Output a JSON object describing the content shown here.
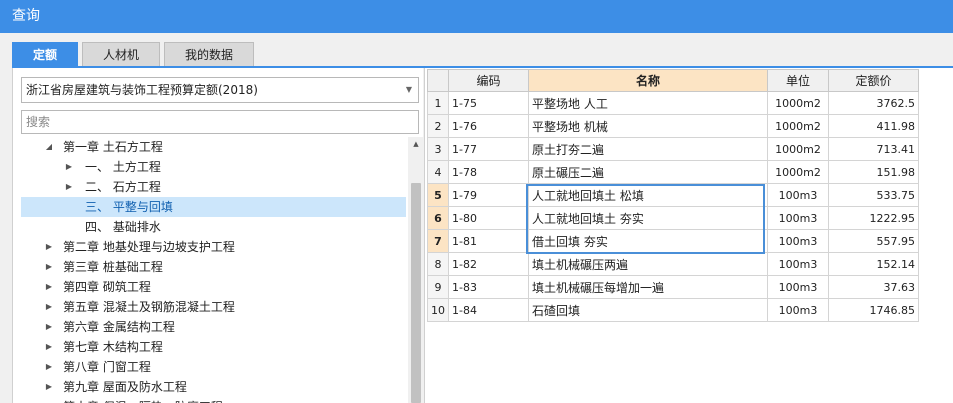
{
  "window": {
    "title": "查询"
  },
  "tabs": [
    {
      "label": "定额",
      "active": true
    },
    {
      "label": "人材机",
      "active": false
    },
    {
      "label": "我的数据",
      "active": false
    }
  ],
  "library": {
    "selected": "浙江省房屋建筑与装饰工程预算定额(2018)"
  },
  "search": {
    "placeholder": "搜索",
    "value": ""
  },
  "tree": [
    {
      "text": "第一章 土石方工程",
      "level": 0,
      "expanded": true,
      "selected": false
    },
    {
      "text": "一、 土方工程",
      "level": 1,
      "expanded": false,
      "selected": false
    },
    {
      "text": "二、 石方工程",
      "level": 1,
      "expanded": false,
      "selected": false
    },
    {
      "text": "三、 平整与回填",
      "level": 1,
      "leaf": true,
      "selected": true
    },
    {
      "text": "四、 基础排水",
      "level": 1,
      "leaf": true,
      "selected": false
    },
    {
      "text": "第二章 地基处理与边坡支护工程",
      "level": 0,
      "expanded": false,
      "selected": false
    },
    {
      "text": "第三章 桩基础工程",
      "level": 0,
      "expanded": false,
      "selected": false
    },
    {
      "text": "第四章 砌筑工程",
      "level": 0,
      "expanded": false,
      "selected": false
    },
    {
      "text": "第五章 混凝土及钢筋混凝土工程",
      "level": 0,
      "expanded": false,
      "selected": false
    },
    {
      "text": "第六章 金属结构工程",
      "level": 0,
      "expanded": false,
      "selected": false
    },
    {
      "text": "第七章 木结构工程",
      "level": 0,
      "expanded": false,
      "selected": false
    },
    {
      "text": "第八章 门窗工程",
      "level": 0,
      "expanded": false,
      "selected": false
    },
    {
      "text": "第九章 屋面及防水工程",
      "level": 0,
      "expanded": false,
      "selected": false
    },
    {
      "text": "第十章 保温、隔热、防腐工程",
      "level": 0,
      "expanded": false,
      "selected": false
    }
  ],
  "table": {
    "columns": [
      "",
      "编码",
      "名称",
      "单位",
      "定额价"
    ],
    "rows": [
      {
        "idx": "1",
        "code": "1-75",
        "name": "平整场地 人工",
        "unit": "1000m2",
        "price": "3762.5",
        "selected": false
      },
      {
        "idx": "2",
        "code": "1-76",
        "name": "平整场地 机械",
        "unit": "1000m2",
        "price": "411.98",
        "selected": false
      },
      {
        "idx": "3",
        "code": "1-77",
        "name": "原土打夯二遍",
        "unit": "1000m2",
        "price": "713.41",
        "selected": false
      },
      {
        "idx": "4",
        "code": "1-78",
        "name": "原土碾压二遍",
        "unit": "1000m2",
        "price": "151.98",
        "selected": false
      },
      {
        "idx": "5",
        "code": "1-79",
        "name": "人工就地回填土 松填",
        "unit": "100m3",
        "price": "533.75",
        "selected": true
      },
      {
        "idx": "6",
        "code": "1-80",
        "name": "人工就地回填土 夯实",
        "unit": "100m3",
        "price": "1222.95",
        "selected": true
      },
      {
        "idx": "7",
        "code": "1-81",
        "name": "借土回填 夯实",
        "unit": "100m3",
        "price": "557.95",
        "selected": true
      },
      {
        "idx": "8",
        "code": "1-82",
        "name": "填土机械碾压两遍",
        "unit": "100m3",
        "price": "152.14",
        "selected": false
      },
      {
        "idx": "9",
        "code": "1-83",
        "name": "填土机械碾压每增加一遍",
        "unit": "100m3",
        "price": "37.63",
        "selected": false
      },
      {
        "idx": "10",
        "code": "1-84",
        "name": "石碴回填",
        "unit": "100m3",
        "price": "1746.85",
        "selected": false
      }
    ]
  },
  "colors": {
    "accent": "#3d8ee6",
    "header_highlight": "#fce4c4",
    "tree_selected": "#cce6fb"
  },
  "icons": {
    "tree_collapsed": "triangle-right-icon",
    "tree_expanded": "triangle-down-icon",
    "dropdown": "chevron-down-icon"
  }
}
